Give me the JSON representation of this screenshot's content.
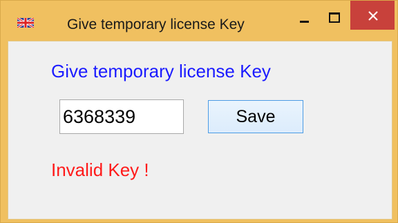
{
  "window": {
    "title": "Give temporary license Key",
    "icon": "uk-flag-icon",
    "controls": {
      "minimize_icon": "minimize-icon",
      "maximize_icon": "maximize-icon",
      "close_icon": "close-icon"
    }
  },
  "form": {
    "heading": "Give temporary license Key",
    "key_value": "6368339",
    "save_label": "Save",
    "error_message": "Invalid Key !"
  },
  "colors": {
    "titlebar": "#f0c060",
    "close_button": "#c8413b",
    "heading": "#1b1bff",
    "error": "#ff1a1a",
    "client_background": "#f0f0f0"
  }
}
